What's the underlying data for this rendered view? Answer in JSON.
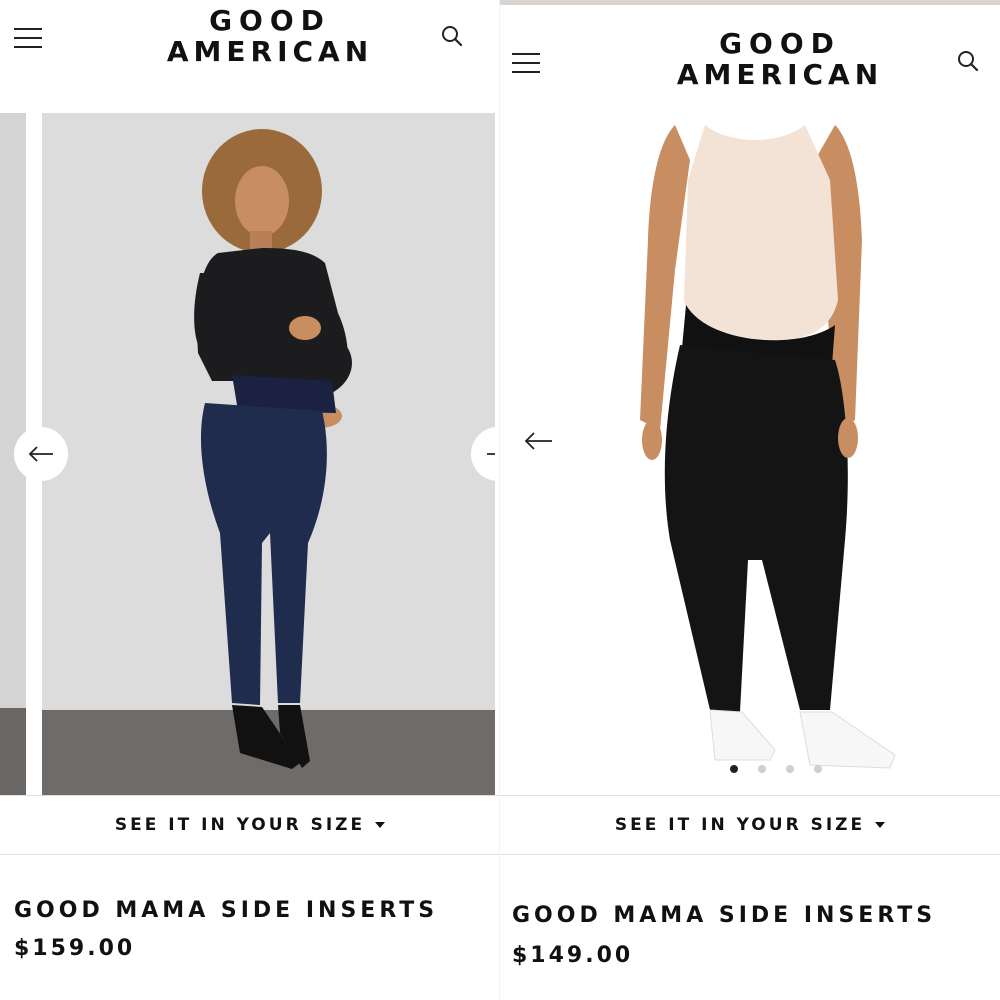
{
  "brand": {
    "line1": "GOOD",
    "line2": "AMERICAN"
  },
  "left": {
    "size_label": "SEE IT IN YOUR SIZE",
    "product_name": "GOOD MAMA SIDE INSERTS",
    "price": "$159.00"
  },
  "right": {
    "size_label": "SEE IT IN YOUR SIZE",
    "product_name": "GOOD MAMA SIDE INSERTS",
    "price": "$149.00",
    "carousel_dots": 4,
    "active_dot": 1
  },
  "colors": {
    "text": "#111111",
    "photo_backdrop": "#dcdcdc",
    "floor": "#6e6b69",
    "denim": "#1f2c4e",
    "black_top": "#1c1c1e",
    "tank_top": "#f3e3d6",
    "skin": "#c98d62"
  },
  "icons": [
    "menu-icon",
    "search-icon",
    "arrow-left-icon",
    "caret-down-icon"
  ]
}
